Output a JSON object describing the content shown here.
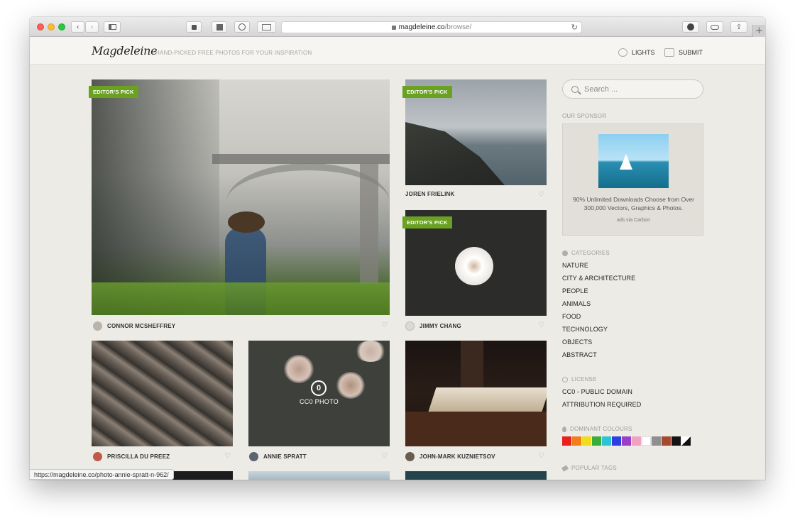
{
  "browser": {
    "url_host": "magdeleine.co",
    "url_path": "/browse/",
    "status_url": "https://magdeleine.co/photo-annie-spratt-n-962/",
    "new_tab_label": "+"
  },
  "site": {
    "logo": "Magdeleine",
    "tagline": "HAND-PICKED FREE PHOTOS FOR YOUR INSPIRATION",
    "lights_label": "LIGHTS",
    "submit_label": "SUBMIT"
  },
  "photos": [
    {
      "author": "CONNOR MCSHEFFREY",
      "badge": "EDITOR'S PICK"
    },
    {
      "author": "JOREN FRIELINK",
      "badge": "EDITOR'S PICK"
    },
    {
      "author": "JIMMY CHANG",
      "badge": "EDITOR'S PICK"
    },
    {
      "author": "PRISCILLA DU PREEZ",
      "badge": ""
    },
    {
      "author": "ANNIE SPRATT",
      "badge": "",
      "overlay": "CC0 PHOTO",
      "overlay_symbol": "0"
    },
    {
      "author": "JOHN-MARK KUZNIETSOV",
      "badge": ""
    }
  ],
  "sidebar": {
    "search_placeholder": "Search ...",
    "sponsor_heading": "OUR SPONSOR",
    "ad_text": "90% Unlimited Downloads Choose from Over 300,000 Vectors, Graphics & Photos.",
    "ad_via": "ads via Carbon",
    "categories_heading": "CATEGORIES",
    "categories": [
      "NATURE",
      "CITY & ARCHITECTURE",
      "PEOPLE",
      "ANIMALS",
      "FOOD",
      "TECHNOLOGY",
      "OBJECTS",
      "ABSTRACT"
    ],
    "license_heading": "LICENSE",
    "licenses": [
      "CC0 - PUBLIC DOMAIN",
      "ATTRIBUTION REQUIRED"
    ],
    "colours_heading": "DOMINANT COLOURS",
    "colours": [
      "#e8201f",
      "#f07f19",
      "#f1dc1d",
      "#3aac3a",
      "#2cc3d3",
      "#2d3fe0",
      "#9b3fc6",
      "#f2a1c3",
      "#ffffff",
      "#8f8f8f",
      "#a44a2e",
      "#141414"
    ],
    "tags_heading": "POPULAR TAGS"
  },
  "accent": "#6aa121"
}
